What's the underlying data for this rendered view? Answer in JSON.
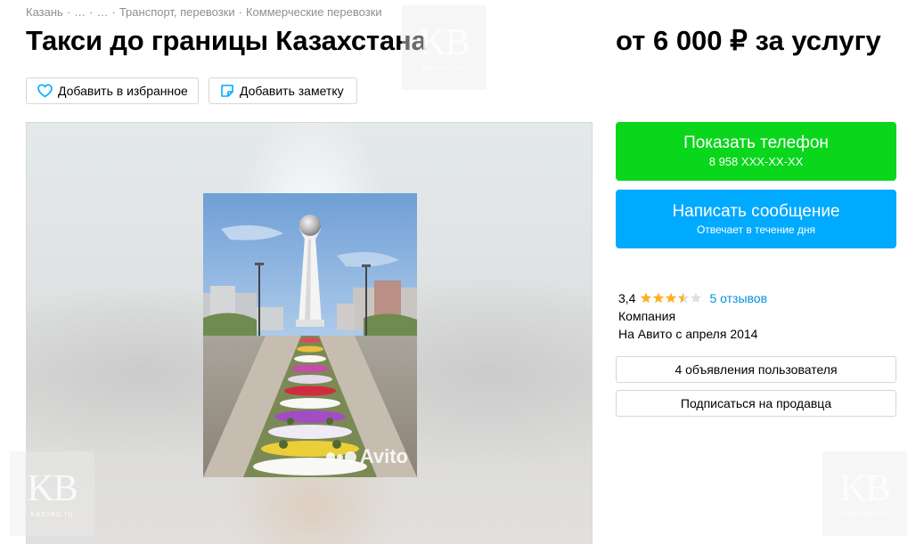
{
  "breadcrumb": {
    "items": [
      "Казань",
      "…",
      "…",
      "Транспорт, перевозки",
      "Коммерческие перевозки"
    ]
  },
  "listing": {
    "title": "Такси до границы Казахстана",
    "price": "от 6 000 ₽ за услугу"
  },
  "actions": {
    "favorite_label": "Добавить в избранное",
    "note_label": "Добавить заметку"
  },
  "gallery": {
    "watermark": "Avito"
  },
  "contact": {
    "show_phone_label": "Показать телефон",
    "phone_masked": "8 958 XXX-XX-XX",
    "write_label": "Написать сообщение",
    "write_sub": "Отвечает в течение дня"
  },
  "seller": {
    "rating": "3,4",
    "rating_value": 3.4,
    "rating_max": 5,
    "reviews_link": "5 отзывов",
    "type": "Компания",
    "since": "На Авито с апреля 2014",
    "ads_button": "4 объявления пользователя",
    "subscribe_button": "Подписаться на продавца"
  },
  "kb_watermark": {
    "logo": "KB",
    "site": "kazved.ru"
  },
  "colors": {
    "green": "#0ad61c",
    "blue": "#00aaff",
    "link": "#0091d9",
    "star": "#ffb021"
  }
}
